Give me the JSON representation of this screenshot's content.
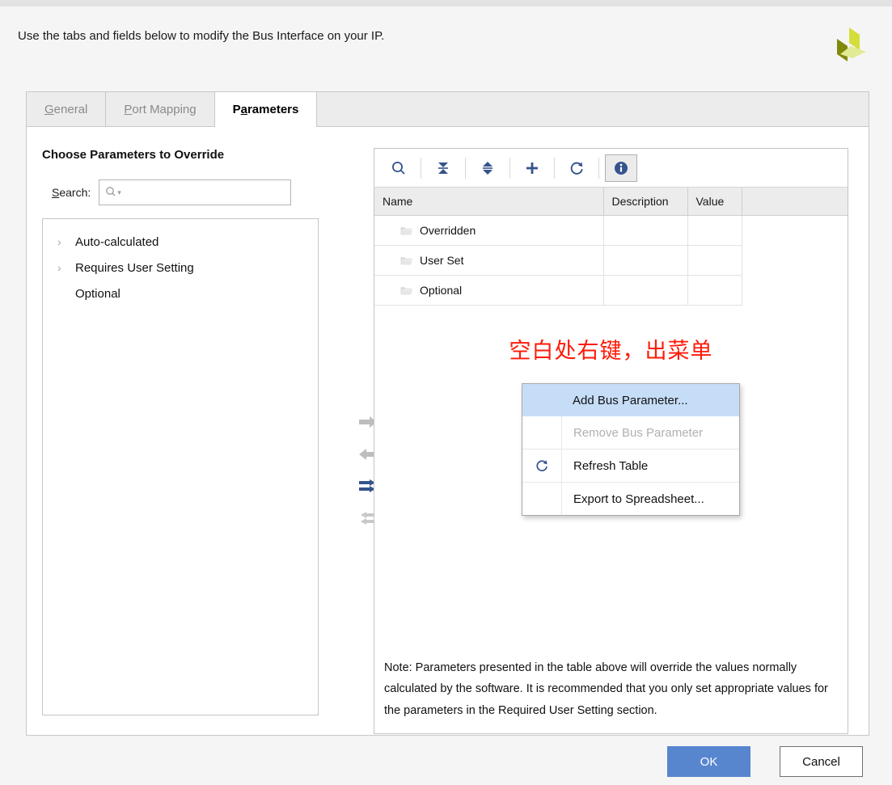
{
  "header": {
    "instruction": "Use the tabs and fields below to modify the Bus Interface on your IP.",
    "logo_name": "xilinx-logo",
    "logo_colors": [
      "#d4de3a",
      "#7f8a0b",
      "#e3ea95"
    ]
  },
  "tabs": [
    {
      "label": "General",
      "mnemonic": "G",
      "active": false
    },
    {
      "label": "Port Mapping",
      "mnemonic": "P",
      "active": false
    },
    {
      "label": "Parameters",
      "mnemonic": "a",
      "active": true
    }
  ],
  "left_pane": {
    "title": "Choose Parameters to Override",
    "search": {
      "label": "Search:",
      "mnemonic": "S",
      "value": "",
      "placeholder": "",
      "icon": "search-icon"
    },
    "tree_items": [
      {
        "label": "Auto-calculated",
        "expandable": true
      },
      {
        "label": "Requires User Setting",
        "expandable": true
      },
      {
        "label": "Optional",
        "expandable": false
      }
    ]
  },
  "transfer_buttons": [
    {
      "name": "move-right-button",
      "icon": "arrow-right-icon",
      "enabled": false
    },
    {
      "name": "move-left-button",
      "icon": "arrow-left-icon",
      "enabled": false
    },
    {
      "name": "move-all-right-button",
      "icon": "double-arrow-right-icon",
      "enabled": true
    },
    {
      "name": "move-all-left-button",
      "icon": "double-arrow-left-icon",
      "enabled": false
    }
  ],
  "right_pane": {
    "toolbar": [
      {
        "name": "search-button",
        "icon": "search-icon",
        "pressed": false
      },
      {
        "name": "collapse-all-button",
        "icon": "collapse-all-icon",
        "pressed": false
      },
      {
        "name": "expand-all-button",
        "icon": "expand-all-icon",
        "pressed": false
      },
      {
        "name": "add-button",
        "icon": "plus-icon",
        "pressed": false
      },
      {
        "name": "refresh-button",
        "icon": "refresh-icon",
        "pressed": false
      },
      {
        "name": "info-button",
        "icon": "info-icon",
        "pressed": true
      }
    ],
    "table": {
      "columns": [
        "Name",
        "Description",
        "Value",
        ""
      ],
      "rows": [
        {
          "name": "Overridden",
          "description": "",
          "value": "",
          "icon": "folder-icon"
        },
        {
          "name": "User Set",
          "description": "",
          "value": "",
          "icon": "folder-icon"
        },
        {
          "name": "Optional",
          "description": "",
          "value": "",
          "icon": "folder-icon"
        }
      ]
    },
    "annotation": "空白处右键，出菜单",
    "annotation_color": "#ff1a07",
    "context_menu": [
      {
        "label": "Add Bus Parameter...",
        "state": "selected",
        "icon": ""
      },
      {
        "label": "Remove Bus Parameter",
        "state": "disabled",
        "icon": ""
      },
      {
        "label": "Refresh Table",
        "state": "normal",
        "icon": "refresh-icon"
      },
      {
        "label": "Export to Spreadsheet...",
        "state": "normal",
        "icon": ""
      }
    ],
    "note": "Note: Parameters presented in the table above will override the values normally calculated by the software. It is recommended that you only set appropriate values for the parameters in the Required User Setting section."
  },
  "footer": {
    "ok_label": "OK",
    "cancel_label": "Cancel",
    "ok_color": "#5786cf"
  }
}
